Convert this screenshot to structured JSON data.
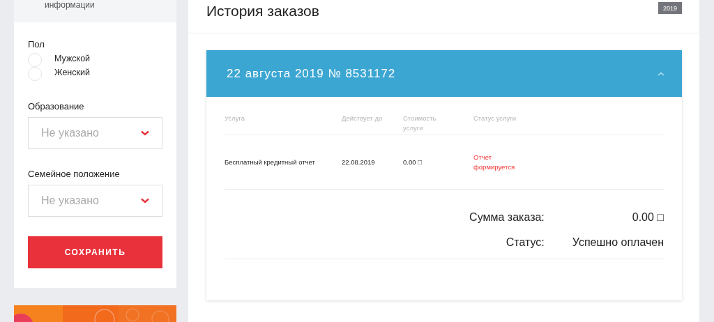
{
  "sidebar": {
    "section_title": "информации",
    "gender": {
      "label": "Пол",
      "options": [
        {
          "label": "Мужской",
          "selected": false
        },
        {
          "label": "Женский",
          "selected": false
        }
      ]
    },
    "selects": [
      {
        "label": "Образование",
        "placeholder": "Не указано"
      },
      {
        "label": "Семейное положение",
        "placeholder": "Не указано"
      }
    ],
    "save_button": "СОХРАНИТЬ"
  },
  "orders": {
    "title": "История заказов",
    "year_badge": "2019",
    "order": {
      "title": "22 августа 2019 № 8531172",
      "expanded": true,
      "columns": [
        "Услуга",
        "Действует до",
        "Стоимость услуги",
        "Статус услуги"
      ],
      "rows": [
        {
          "service": "Бесплатный кредитный отчет",
          "valid_until": "22.08.2019",
          "price": "0.00 □",
          "status": "Отчет формируется"
        }
      ],
      "summary": [
        {
          "label": "Сумма заказа:",
          "value": "0.00 □"
        },
        {
          "label": "Статус:",
          "value": "Успешно оплачен"
        }
      ]
    }
  }
}
